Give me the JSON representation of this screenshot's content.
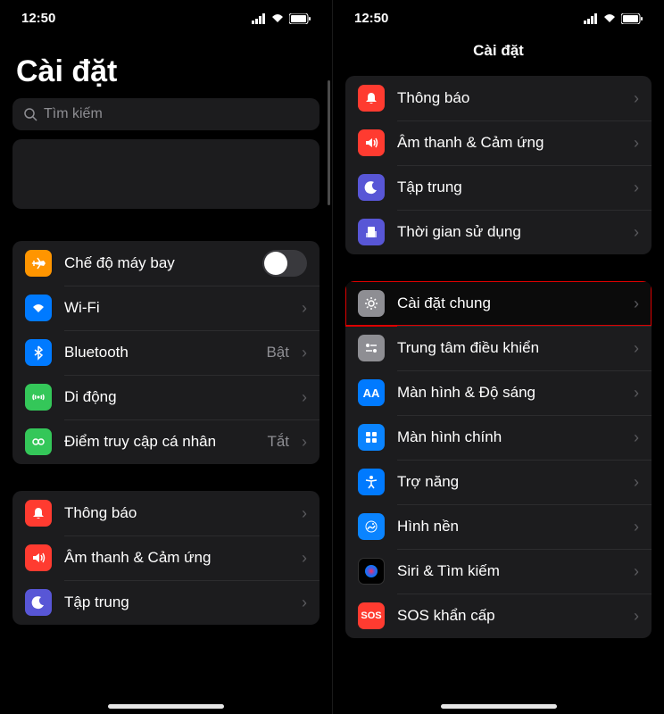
{
  "status": {
    "time": "12:50"
  },
  "left": {
    "title": "Cài đặt",
    "search_placeholder": "Tìm kiếm",
    "group1": [
      {
        "label": "Chế độ máy bay",
        "icon": "airplane-icon",
        "color": "ic-orange",
        "type": "toggle"
      },
      {
        "label": "Wi-Fi",
        "icon": "wifi-icon",
        "color": "ic-blue",
        "type": "nav"
      },
      {
        "label": "Bluetooth",
        "icon": "bluetooth-icon",
        "color": "ic-blue",
        "type": "nav",
        "detail": "Bật"
      },
      {
        "label": "Di động",
        "icon": "cellular-icon",
        "color": "ic-green",
        "type": "nav"
      },
      {
        "label": "Điểm truy cập cá nhân",
        "icon": "hotspot-icon",
        "color": "ic-green",
        "type": "nav",
        "detail": "Tắt"
      }
    ],
    "group2": [
      {
        "label": "Thông báo",
        "icon": "notifications-icon",
        "color": "ic-red",
        "type": "nav"
      },
      {
        "label": "Âm thanh & Cảm ứng",
        "icon": "sounds-icon",
        "color": "ic-red",
        "type": "nav"
      },
      {
        "label": "Tập trung",
        "icon": "focus-icon",
        "color": "ic-purple",
        "type": "nav"
      }
    ]
  },
  "right": {
    "title": "Cài đặt",
    "group1": [
      {
        "label": "Thông báo",
        "icon": "notifications-icon",
        "color": "ic-red",
        "type": "nav"
      },
      {
        "label": "Âm thanh & Cảm ứng",
        "icon": "sounds-icon",
        "color": "ic-red",
        "type": "nav"
      },
      {
        "label": "Tập trung",
        "icon": "focus-icon",
        "color": "ic-purple",
        "type": "nav"
      },
      {
        "label": "Thời gian sử dụng",
        "icon": "screentime-icon",
        "color": "ic-purple",
        "type": "nav"
      }
    ],
    "group2": [
      {
        "label": "Cài đặt chung",
        "icon": "general-icon",
        "color": "ic-gray",
        "type": "nav",
        "highlighted": true
      },
      {
        "label": "Trung tâm điều khiển",
        "icon": "control-center-icon",
        "color": "ic-gray",
        "type": "nav"
      },
      {
        "label": "Màn hình & Độ sáng",
        "icon": "display-icon",
        "color": "ic-blue",
        "type": "nav"
      },
      {
        "label": "Màn hình chính",
        "icon": "homescreen-icon",
        "color": "ic-darkblue",
        "type": "nav"
      },
      {
        "label": "Trợ năng",
        "icon": "accessibility-icon",
        "color": "ic-blue",
        "type": "nav"
      },
      {
        "label": "Hình nền",
        "icon": "wallpaper-icon",
        "color": "ic-darkblue",
        "type": "nav"
      },
      {
        "label": "Siri & Tìm kiếm",
        "icon": "siri-icon",
        "color": "ic-black",
        "type": "nav"
      },
      {
        "label": "SOS khẩn cấp",
        "icon": "sos-icon",
        "color": "ic-red",
        "type": "nav"
      }
    ]
  }
}
